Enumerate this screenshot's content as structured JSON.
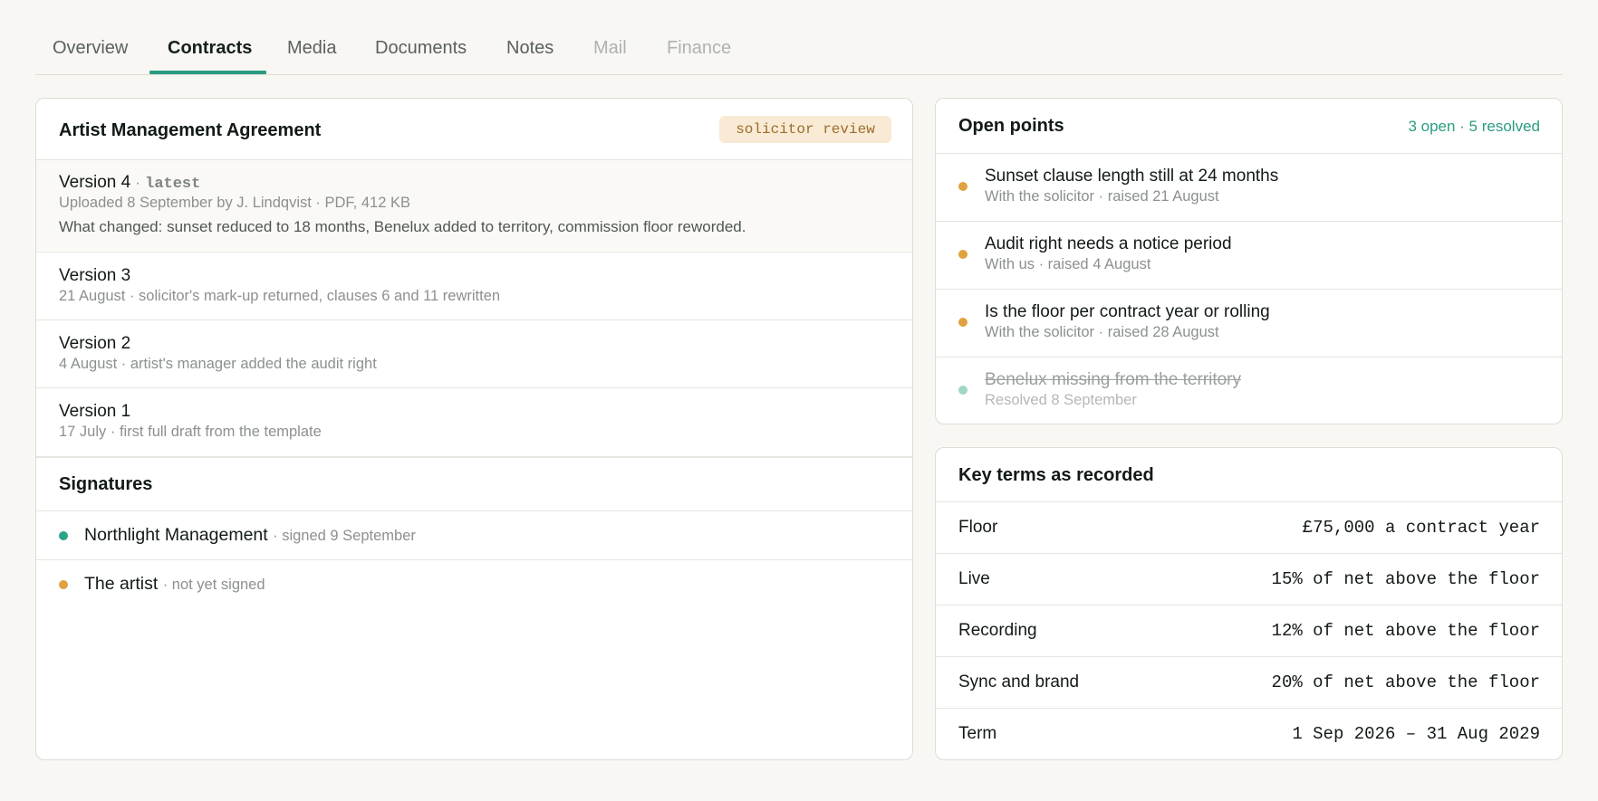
{
  "tabs": [
    {
      "label": "Overview",
      "state": "normal"
    },
    {
      "label": "Contracts",
      "state": "active"
    },
    {
      "label": "Media",
      "state": "normal"
    },
    {
      "label": "Documents",
      "state": "normal"
    },
    {
      "label": "Notes",
      "state": "normal"
    },
    {
      "label": "Mail",
      "state": "disabled"
    },
    {
      "label": "Finance",
      "state": "disabled"
    }
  ],
  "contract": {
    "title": "Artist Management Agreement",
    "status": "solicitor review",
    "versions": [
      {
        "label": "Version 4",
        "separator": "·",
        "tag": "latest",
        "meta": "Uploaded 8 September by J. Lindqvist · PDF, 412 KB",
        "changes": "What changed: sunset reduced to 18 months, Benelux added to territory, commission floor reworded."
      },
      {
        "label": "Version 3",
        "meta": "21 August · solicitor's mark-up returned, clauses 6 and 11 rewritten"
      },
      {
        "label": "Version 2",
        "meta": "4 August · artist's manager added the audit right"
      },
      {
        "label": "Version 1",
        "meta": "17 July · first full draft from the template"
      }
    ],
    "signatures": {
      "title": "Signatures",
      "items": [
        {
          "name": "Northlight Management",
          "status": "· signed 9 September",
          "color": "#2aa386"
        },
        {
          "name": "The artist",
          "status": "· not yet signed",
          "color": "#e0a23e"
        }
      ]
    }
  },
  "open_points": {
    "title": "Open points",
    "summary": "3 open · 5 resolved",
    "items": [
      {
        "title": "Sunset clause length still at 24 months",
        "meta": "With the solicitor · raised 21 August",
        "status": "open",
        "color": "#e0a23e"
      },
      {
        "title": "Audit right needs a notice period",
        "meta": "With us · raised 4 August",
        "status": "open",
        "color": "#e0a23e"
      },
      {
        "title": "Is the floor per contract year or rolling",
        "meta": "With the solicitor · raised 28 August",
        "status": "open",
        "color": "#e0a23e"
      },
      {
        "title": "Benelux missing from the territory",
        "meta": "Resolved 8 September",
        "status": "resolved",
        "color": "#9fd8c6"
      }
    ]
  },
  "key_terms": {
    "title": "Key terms as recorded",
    "rows": [
      {
        "label": "Floor",
        "value": "£75,000 a contract year"
      },
      {
        "label": "Live",
        "value": "15% of net above the floor"
      },
      {
        "label": "Recording",
        "value": "12% of net above the floor"
      },
      {
        "label": "Sync and brand",
        "value": "20% of net above the floor"
      },
      {
        "label": "Term",
        "value": "1 Sep 2026 – 31 Aug 2029"
      }
    ]
  }
}
